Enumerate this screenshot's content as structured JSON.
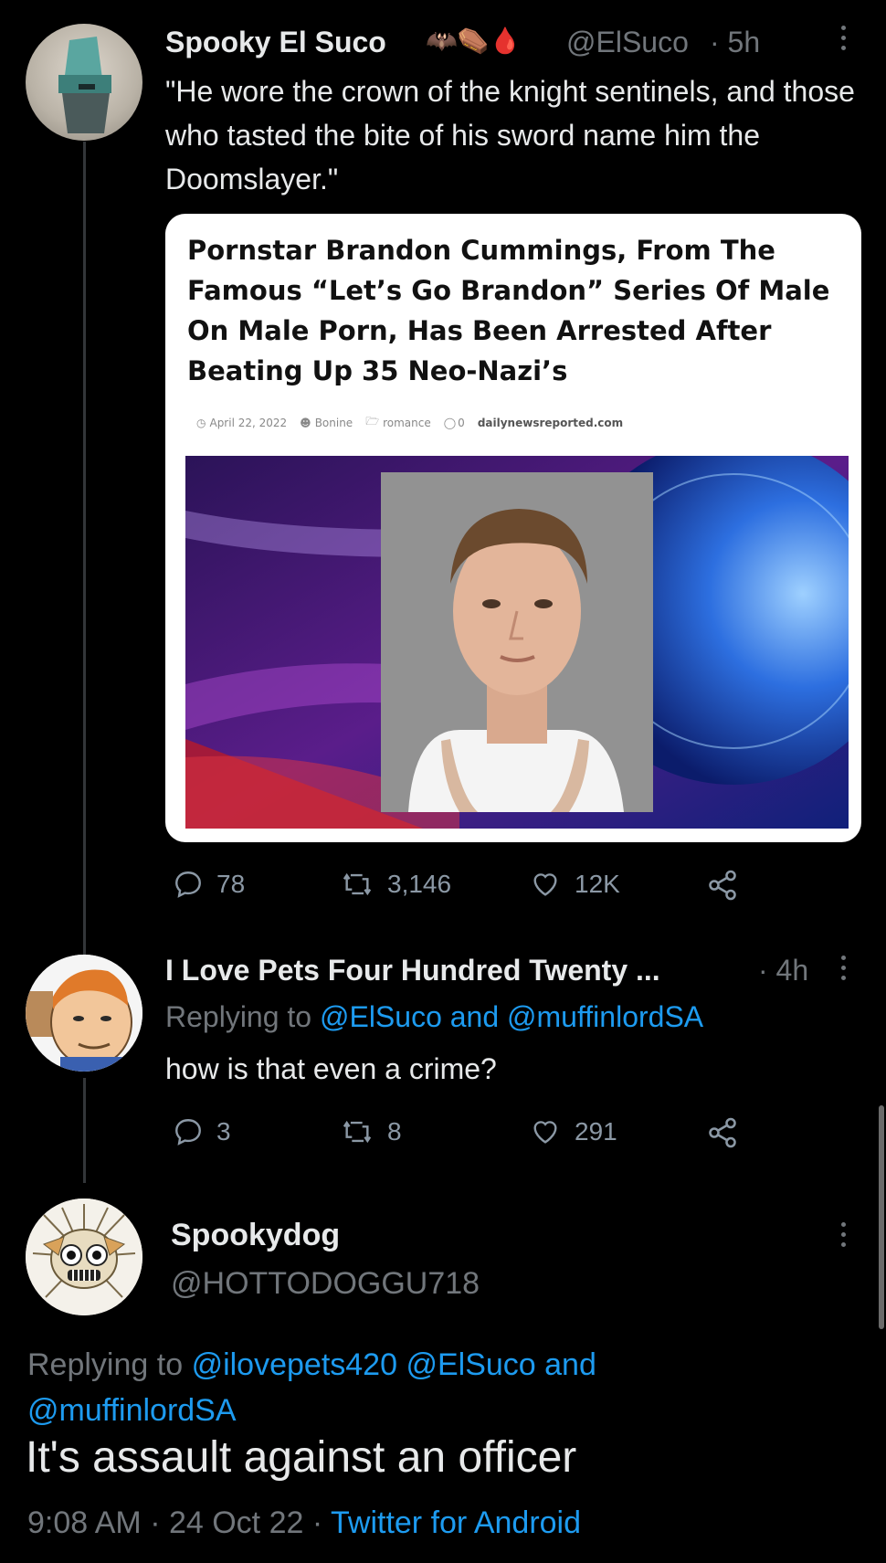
{
  "tweets": [
    {
      "name": "Spooky El Suco",
      "name_emoji": "🦇⚰️🩸",
      "handle": "@ElSuco",
      "time": "· 5h",
      "text": "\"He wore the crown of the knight sentinels, and those who tasted the bite of his sword name him the Doomslayer.\"",
      "card": {
        "headline": "Pornstar Brandon Cummings, From The Famous “Let’s Go Brandon” Series Of Male On Male Porn, Has Been Arrested After Beating Up 35 Neo-Nazi’s",
        "date": "April 22, 2022",
        "author": "Bonine",
        "category": "romance",
        "comments": "0",
        "site": "dailynewsreported.com"
      },
      "replies": "78",
      "retweets": "3,146",
      "likes": "12K"
    },
    {
      "name": "I Love Pets Four Hundred Twenty ...",
      "time": "· 4h",
      "replying_prefix": "Replying to",
      "replying_to": "@ElSuco and @muffinlordSA",
      "text": "how is that even a crime?",
      "replies": "3",
      "retweets": "8",
      "likes": "291"
    }
  ],
  "main_tweet": {
    "name": "Spookydog",
    "handle": "@HOTTODOGGU718",
    "replying_prefix": "Replying to",
    "replying_to_line1": "@ilovepets420 @ElSuco and",
    "replying_to_line2": "@muffinlordSA",
    "text": "It's assault against an officer",
    "timestamp": "9:08 AM · 24 Oct 22 ·",
    "client": "Twitter for Android"
  },
  "colors": {
    "background": "#000000",
    "text": "#e7e9ea",
    "muted": "#71767b",
    "link": "#1d9bf0"
  }
}
